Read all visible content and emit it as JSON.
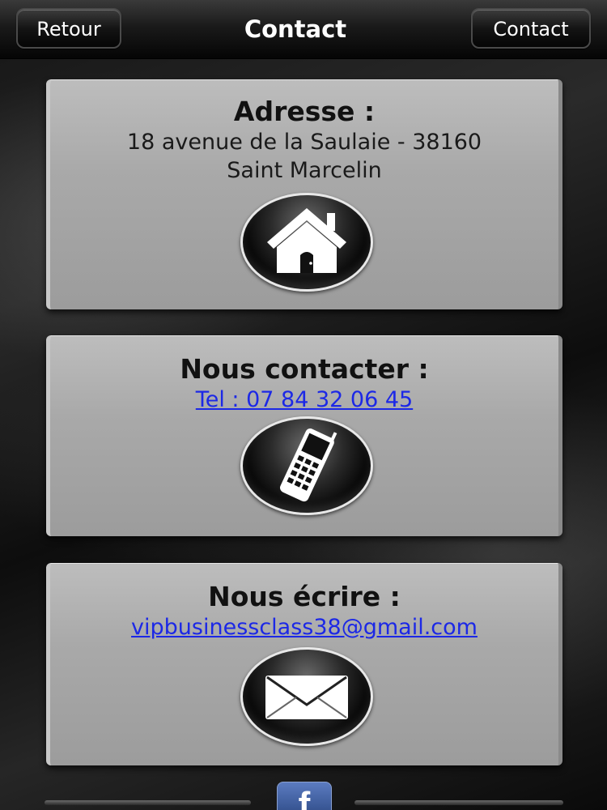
{
  "navbar": {
    "back_label": "Retour",
    "title": "Contact",
    "right_label": "Contact"
  },
  "address": {
    "title": "Adresse :",
    "line1": "18 avenue de la Saulaie - 38160",
    "line2": "Saint Marcelin",
    "icon": "home-icon"
  },
  "phone": {
    "title": "Nous contacter :",
    "link": "Tel : 07 84 32 06 45",
    "icon": "mobile-phone-icon"
  },
  "email": {
    "title": "Nous écrire :",
    "link": "vipbusinessclass38@gmail.com",
    "icon": "envelope-icon"
  },
  "footer": {
    "facebook_letter": "f",
    "icon": "facebook-icon"
  },
  "colors": {
    "link": "#1c28e6",
    "card": "#a9a9a9",
    "facebook": "#3b5998"
  }
}
